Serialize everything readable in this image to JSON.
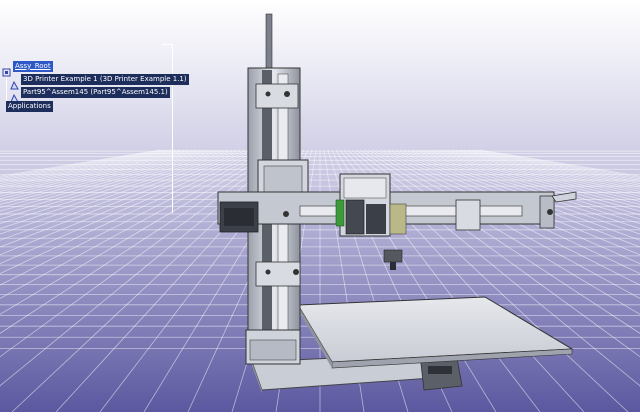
{
  "app": {
    "view": "3d-viewport"
  },
  "tree": {
    "root": "Assy_Root",
    "children": [
      "3D Printer Example 1 (3D Printer Example 1.1)",
      "Part95^Assem145 (Part95^Assem145.1)"
    ],
    "applications": "Applications"
  },
  "colors": {
    "tree_label_bg": "#1d2d5c",
    "tree_selected_bg": "#2d58c8",
    "grid": "#ffffff",
    "metal": "#cfd3dc",
    "dark_metal": "#4a4f5a"
  },
  "icons": [
    "assembly-icon",
    "product-icon",
    "part-icon"
  ]
}
